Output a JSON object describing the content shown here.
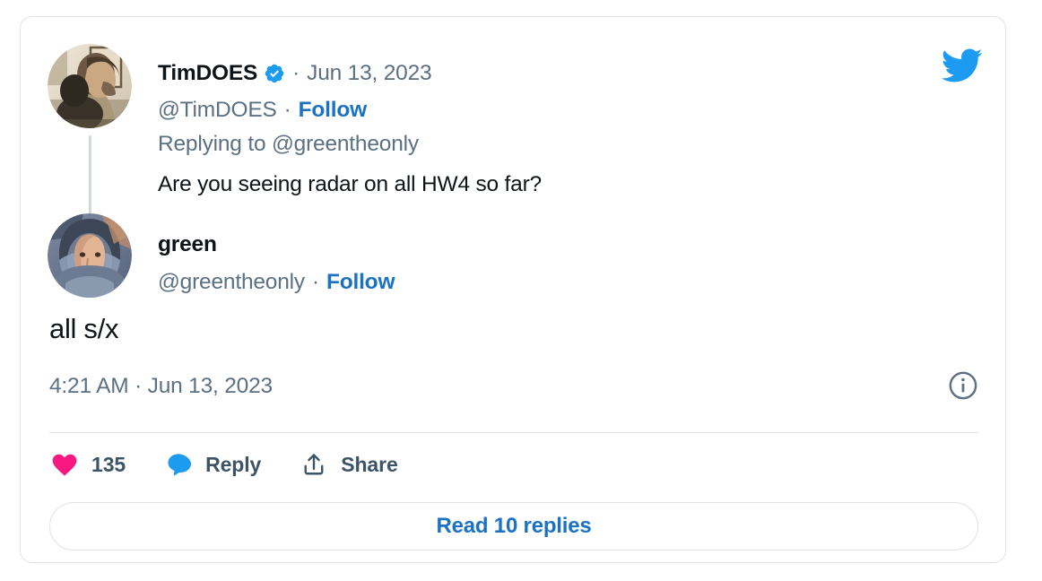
{
  "card": {
    "brand_icon": "twitter-bird-icon",
    "brand_color": "#1d9bf0",
    "border_color": "#dfe3e6"
  },
  "parent_tweet": {
    "avatar_alt": "avatar-timdoes",
    "display_name": "TimDOES",
    "verified": true,
    "verified_icon": "verified-badge-icon",
    "separator": "·",
    "date": "Jun 13, 2023",
    "handle": "@TimDOES",
    "follow_label": "Follow",
    "replying_to": "Replying to @greentheonly",
    "body": "Are you seeing radar on all HW4 so far?"
  },
  "main_tweet": {
    "avatar_alt": "avatar-greentheonly",
    "display_name": "green",
    "handle": "@greentheonly",
    "separator": "·",
    "follow_label": "Follow",
    "body": "all s/x",
    "timestamp": "4:21 AM · Jun 13, 2023",
    "info_icon": "info-circle-icon"
  },
  "actions": {
    "like": {
      "icon": "heart-icon",
      "color": "#f91880",
      "count": "135"
    },
    "reply": {
      "icon": "comment-bubble-icon",
      "color": "#1d9bf0",
      "label": "Reply"
    },
    "share": {
      "icon": "share-upload-icon",
      "color": "#3d5466",
      "label": "Share"
    }
  },
  "read_replies": {
    "label": "Read 10 replies",
    "color": "#1b72c4"
  }
}
